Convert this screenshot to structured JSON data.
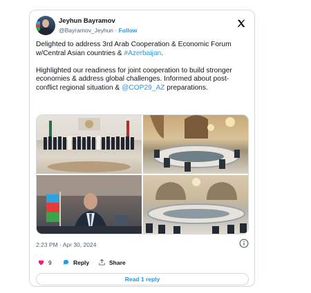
{
  "author": {
    "name": "Jeyhun Bayramov",
    "handle": "@Bayramov_Jeyhun",
    "separator": "·",
    "follow_label": "Follow"
  },
  "tweet": {
    "p1_text": "Delighted to address 3rd Arab Cooperation & Economic Forum w/Central Asian countries & ",
    "p1_hashtag": "#Azerbaijan",
    "p1_end": ".",
    "p2_text": "Highlighted our readiness for joint cooperation to build stronger economies & address global challenges. Informed about post-conflict regional situation & ",
    "p2_mention": "@COP29_AZ",
    "p2_end": " preparations."
  },
  "media": {
    "image_count": 4
  },
  "meta": {
    "timestamp": "2:23 PM · Apr 30, 2024"
  },
  "actions": {
    "like_count": "9",
    "reply_label": "Reply",
    "share_label": "Share"
  },
  "read_replies_label": "Read 1 reply",
  "colors": {
    "accent": "#1d9bf0",
    "like": "#f91880",
    "secondary_text": "#536471",
    "border": "#cfd9de"
  },
  "icons": [
    "x-logo-icon",
    "info-icon",
    "heart-icon",
    "reply-bubble-icon",
    "share-icon"
  ]
}
